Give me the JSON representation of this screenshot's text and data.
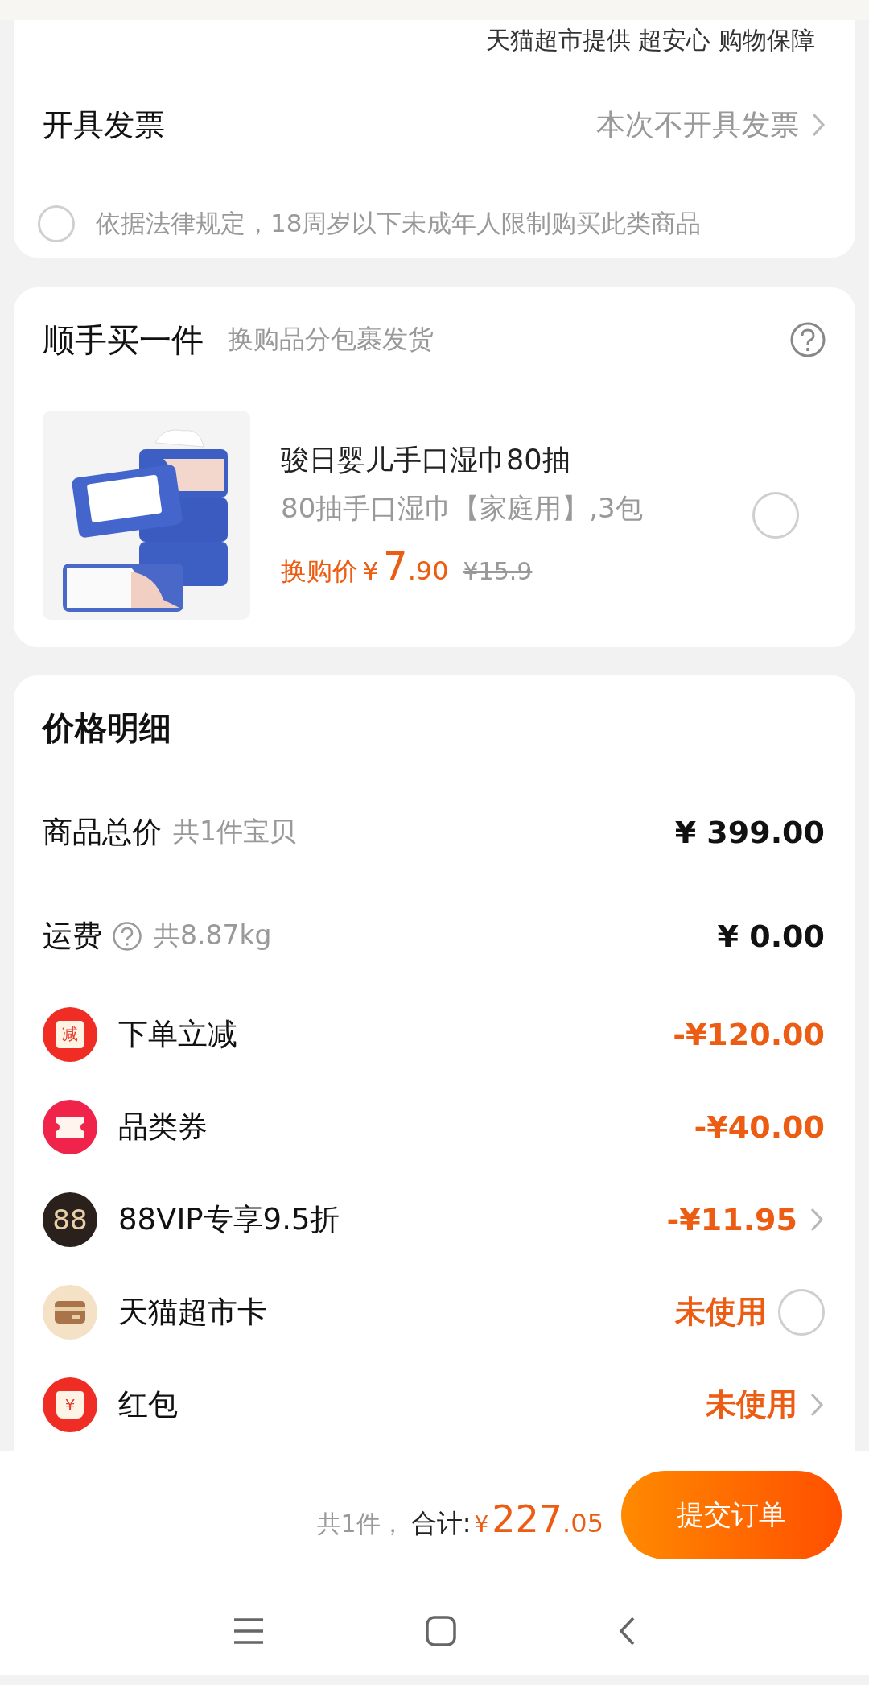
{
  "top_notice": "天猫超市提供 超安心 购物保障",
  "invoice": {
    "label": "开具发票",
    "value": "本次不开具发票"
  },
  "age_notice": {
    "text": "依据法律规定，18周岁以下未成年人限制购买此类商品",
    "checked": false
  },
  "addon": {
    "title": "顺手买一件",
    "subtitle": "换购品分包裹发货",
    "item": {
      "name": "骏日婴儿手口湿巾80抽",
      "spec": "80抽手口湿巾【家庭用】,3包",
      "price_label": "换购价",
      "currency": "¥",
      "price_int": "7",
      "price_dec": ".90",
      "original_price": "¥15.9",
      "selected": false
    }
  },
  "price_detail": {
    "title": "价格明细",
    "rows": [
      {
        "kind": "total",
        "label": "商品总价",
        "note": "共1件宝贝",
        "amount": "¥ 399.00"
      },
      {
        "kind": "shipping",
        "label": "运费",
        "note": "共8.87kg",
        "amount": "¥ 0.00"
      },
      {
        "kind": "instant",
        "badge": "减",
        "label": "下单立减",
        "amount": "-¥120.00",
        "chevron": false
      },
      {
        "kind": "coupon",
        "label": "品类券",
        "amount": "-¥40.00",
        "chevron": false
      },
      {
        "kind": "vip",
        "badge": "88",
        "label": "88VIP专享9.5折",
        "amount": "-¥11.95",
        "chevron": true
      },
      {
        "kind": "card",
        "label": "天猫超市卡",
        "amount": "未使用",
        "checked": false
      },
      {
        "kind": "redpacket",
        "badge": "¥",
        "label": "红包",
        "amount": "未使用",
        "chevron": true
      }
    ]
  },
  "footer": {
    "count": "共1件，",
    "total_label": "合计:",
    "currency": "¥",
    "total_int": "227",
    "total_dec": ".05",
    "submit": "提交订单"
  }
}
